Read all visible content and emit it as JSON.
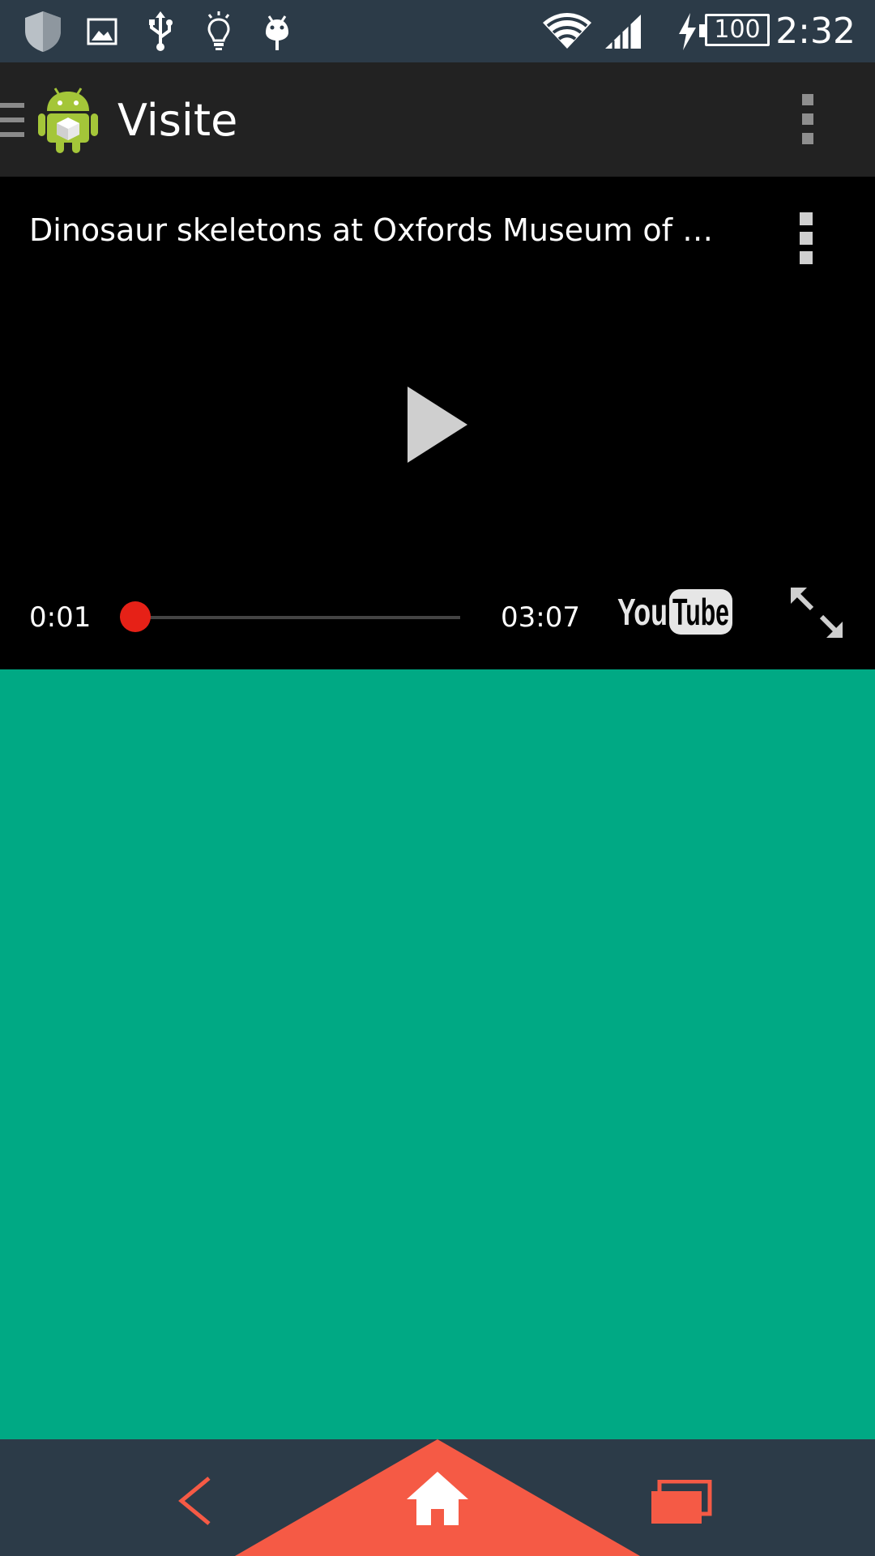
{
  "status_bar": {
    "time": "2:32",
    "battery_level": "100",
    "icons": [
      "shield-icon",
      "image-icon",
      "usb-icon",
      "lightbulb-icon",
      "android-debug-icon",
      "wifi-icon",
      "signal-icon",
      "charging-icon",
      "battery-icon"
    ]
  },
  "action_bar": {
    "title": "Visite",
    "icons": [
      "drawer-icon",
      "android-logo-icon",
      "overflow-menu-icon"
    ]
  },
  "player": {
    "video_title": "Dinosaur skeletons at Oxfords Museum of N…",
    "current_time": "0:01",
    "total_time": "03:07",
    "progress_fraction": 0.005,
    "colors": {
      "progress": "#e62117",
      "background": "#000000"
    }
  },
  "content": {
    "background_color": "#00a984"
  },
  "nav_bar": {
    "icons": [
      "back-icon",
      "home-icon",
      "recent-apps-icon"
    ],
    "accent_color": "#f55a45",
    "background_color": "#2c3b48"
  }
}
